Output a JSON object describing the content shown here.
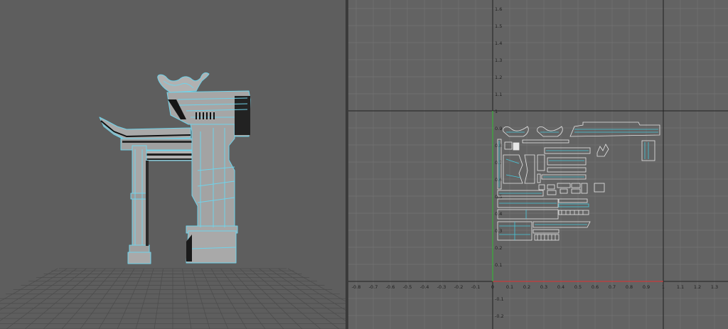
{
  "perspective_view": {
    "background": "#5e5e5e",
    "ground_grid_color": "#4a4a4a",
    "wireframe_color": "#6fd3ea",
    "model_fill": "#a5a5a5"
  },
  "uv_editor": {
    "background": "#636363",
    "grid_color": "#737373",
    "axis_color": "#202020",
    "u_axis_color": "#c83a3a",
    "v_axis_color": "#3ab03a",
    "shell_color": "#e6e6e6",
    "seam_color": "#45c8dc",
    "u_ticks": [
      {
        "v": -0.8,
        "label": "-0.8"
      },
      {
        "v": -0.7,
        "label": "-0.7"
      },
      {
        "v": -0.6,
        "label": "-0.6"
      },
      {
        "v": -0.5,
        "label": "-0.5"
      },
      {
        "v": -0.4,
        "label": "-0.4"
      },
      {
        "v": -0.3,
        "label": "-0.3"
      },
      {
        "v": -0.2,
        "label": "-0.2"
      },
      {
        "v": -0.1,
        "label": "-0.1"
      },
      {
        "v": 0,
        "label": "0"
      },
      {
        "v": 0.1,
        "label": "0.1"
      },
      {
        "v": 0.2,
        "label": "0.2"
      },
      {
        "v": 0.3,
        "label": "0.3"
      },
      {
        "v": 0.4,
        "label": "0.4"
      },
      {
        "v": 0.5,
        "label": "0.5"
      },
      {
        "v": 0.6,
        "label": "0.6"
      },
      {
        "v": 0.7,
        "label": "0.7"
      },
      {
        "v": 0.8,
        "label": "0.8"
      },
      {
        "v": 0.9,
        "label": "0.9"
      },
      {
        "v": 1.0,
        "label": "1"
      },
      {
        "v": 1.1,
        "label": "1.1"
      },
      {
        "v": 1.2,
        "label": "1.2"
      },
      {
        "v": 1.3,
        "label": "1.3"
      }
    ],
    "v_ticks": [
      {
        "v": 1.6,
        "label": "1.6"
      },
      {
        "v": 1.5,
        "label": "1.5"
      },
      {
        "v": 1.4,
        "label": "1.4"
      },
      {
        "v": 1.3,
        "label": "1.3"
      },
      {
        "v": 1.2,
        "label": "1.2"
      },
      {
        "v": 1.1,
        "label": "1.1"
      },
      {
        "v": 1.0,
        "label": "1"
      },
      {
        "v": 0.9,
        "label": "0.9"
      },
      {
        "v": 0.8,
        "label": "0.8"
      },
      {
        "v": 0.7,
        "label": "0.7"
      },
      {
        "v": 0.6,
        "label": "0.6"
      },
      {
        "v": 0.5,
        "label": "0.5"
      },
      {
        "v": 0.4,
        "label": "0.4"
      },
      {
        "v": 0.3,
        "label": "0.3"
      },
      {
        "v": 0.2,
        "label": "0.2"
      },
      {
        "v": 0.1,
        "label": "0.1"
      },
      {
        "v": -0.1,
        "label": "-0.1"
      },
      {
        "v": -0.2,
        "label": "-0.2"
      }
    ]
  }
}
